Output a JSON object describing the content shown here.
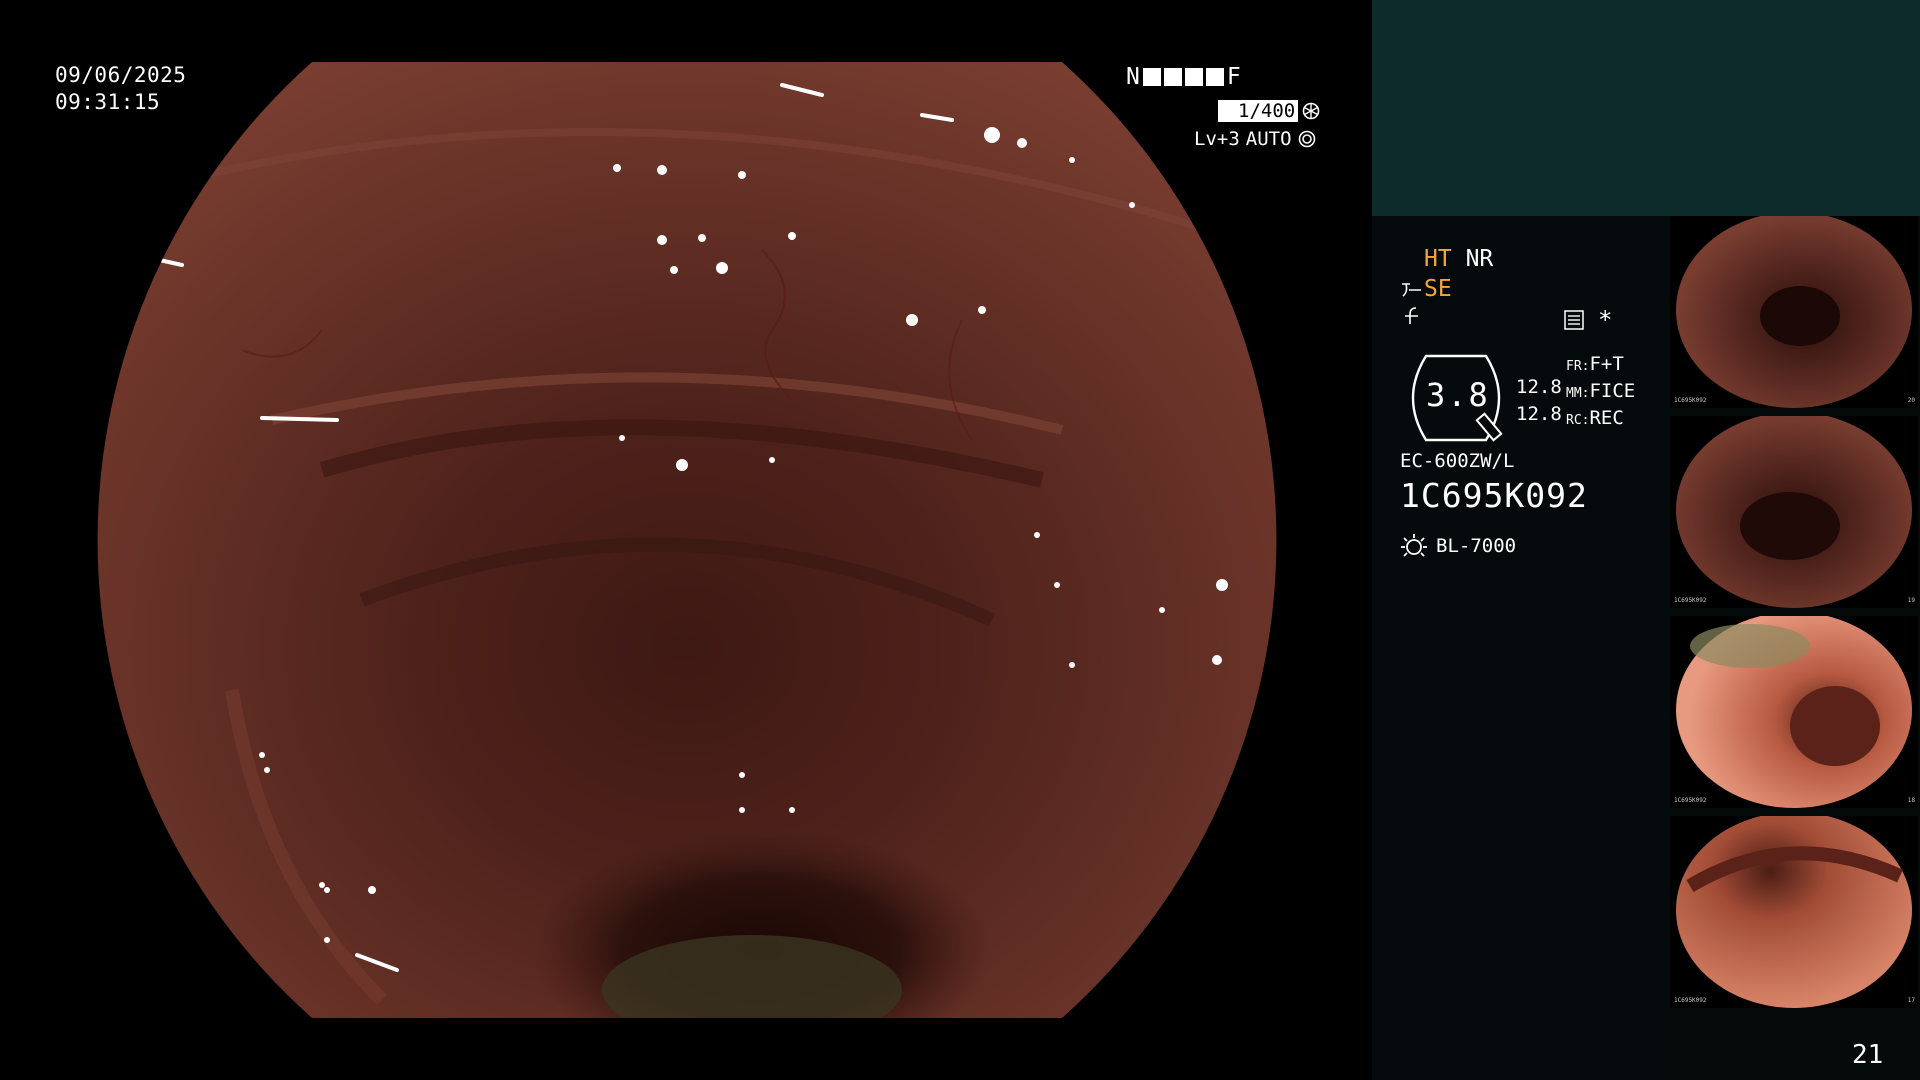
{
  "overlay": {
    "date": "09/06/2025",
    "time": "09:31:15",
    "mode_left": "N",
    "mode_right": "F",
    "shutter": "1/400",
    "level": "Lv+3",
    "iris": "AUTO"
  },
  "panel": {
    "ht": "HT",
    "nr": "NR",
    "se": "SE",
    "zoom": "3.8",
    "values": [
      "12.8",
      "12.8"
    ],
    "labels": [
      {
        "key": "FR:",
        "val": "F+T"
      },
      {
        "key": "MM:",
        "val": "FICE"
      },
      {
        "key": "RC:",
        "val": "REC"
      }
    ],
    "scope_model": "EC-600ZW/L",
    "serial": "1C695K092",
    "lamp": "BL-7000",
    "page_number": "21"
  },
  "thumbnails": [
    {
      "label": "1C695K092",
      "num": "20"
    },
    {
      "label": "1C695K092",
      "num": "19"
    },
    {
      "label": "1C695K092",
      "num": "18"
    },
    {
      "label": "1C695K092",
      "num": "17"
    }
  ],
  "colors": {
    "accent_orange": "#f2a73b",
    "panel_top": "#0e2b2b",
    "panel_bg": "#050b0c",
    "mucosa": "#5a2a22"
  }
}
